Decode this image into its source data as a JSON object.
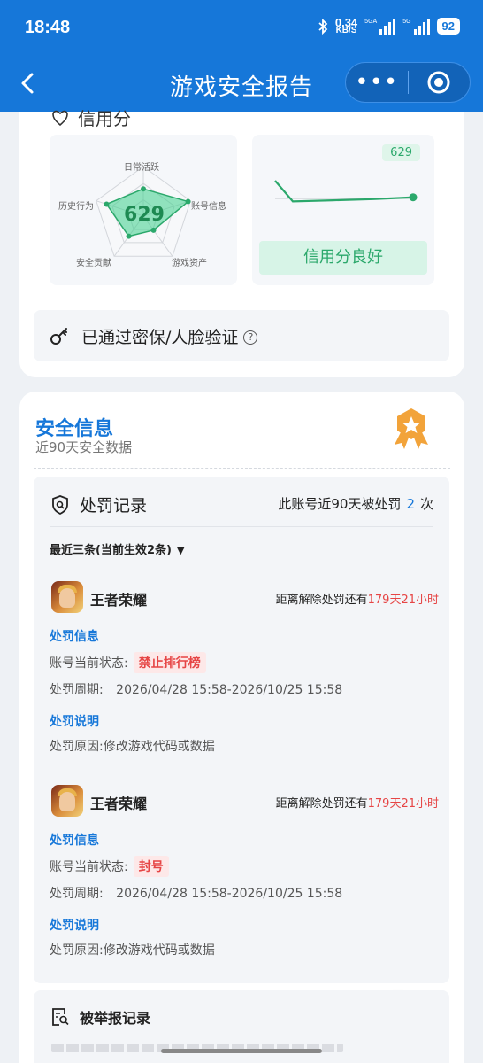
{
  "status_bar": {
    "time": "18:48",
    "net_speed_value": "0.34",
    "net_speed_unit": "KB/S",
    "signal1_label": "5GA",
    "signal2_label": "5G",
    "battery": "92"
  },
  "nav": {
    "title": "游戏安全报告",
    "back_icon": "chevron-left-icon",
    "more_icon": "more-dots-icon",
    "close_icon": "target-icon"
  },
  "credit": {
    "heading": "信用分",
    "score": "629",
    "radar_labels": [
      "日常活跃",
      "账号信息",
      "游戏资产",
      "安全贡献",
      "历史行为"
    ],
    "radar_values": [
      0.55,
      0.95,
      0.35,
      0.5,
      0.78
    ],
    "trend_tag": "629",
    "trend_points": [
      1.0,
      0.1,
      0.15,
      0.2,
      0.28
    ],
    "status_label": "信用分良好",
    "accent_color": "#2ba86b"
  },
  "verification": {
    "text": "已通过密保/人脸验证",
    "help_icon": "question-circle-icon"
  },
  "security": {
    "title": "安全信息",
    "subtitle": "近90天安全数据",
    "medal_icon": "star-medal-icon"
  },
  "punishment": {
    "title": "处罚记录",
    "count_prefix": "此账号近90天被处罚",
    "count": "2",
    "count_suffix": "次",
    "filter": "最近三条(当前生效2条)",
    "records": [
      {
        "game": "王者荣耀",
        "remain_prefix": "距离解除处罚还有",
        "remain": "179天21小时",
        "info_heading": "处罚信息",
        "status_label": "账号当前状态:",
        "status": "禁止排行榜",
        "period_label": "处罚周期:",
        "period": "2026/04/28 15:58-2026/10/25 15:58",
        "desc_heading": "处罚说明",
        "reason": "处罚原因:修改游戏代码或数据"
      },
      {
        "game": "王者荣耀",
        "remain_prefix": "距离解除处罚还有",
        "remain": "179天21小时",
        "info_heading": "处罚信息",
        "status_label": "账号当前状态:",
        "status": "封号",
        "period_label": "处罚周期:",
        "period": "2026/04/28 15:58-2026/10/25 15:58",
        "desc_heading": "处罚说明",
        "reason": "处罚原因:修改游戏代码或数据"
      }
    ]
  },
  "report": {
    "title": "被举报记录"
  },
  "colors": {
    "primary": "#1677d9",
    "danger": "#e64545",
    "medal": "#f2a33a"
  }
}
